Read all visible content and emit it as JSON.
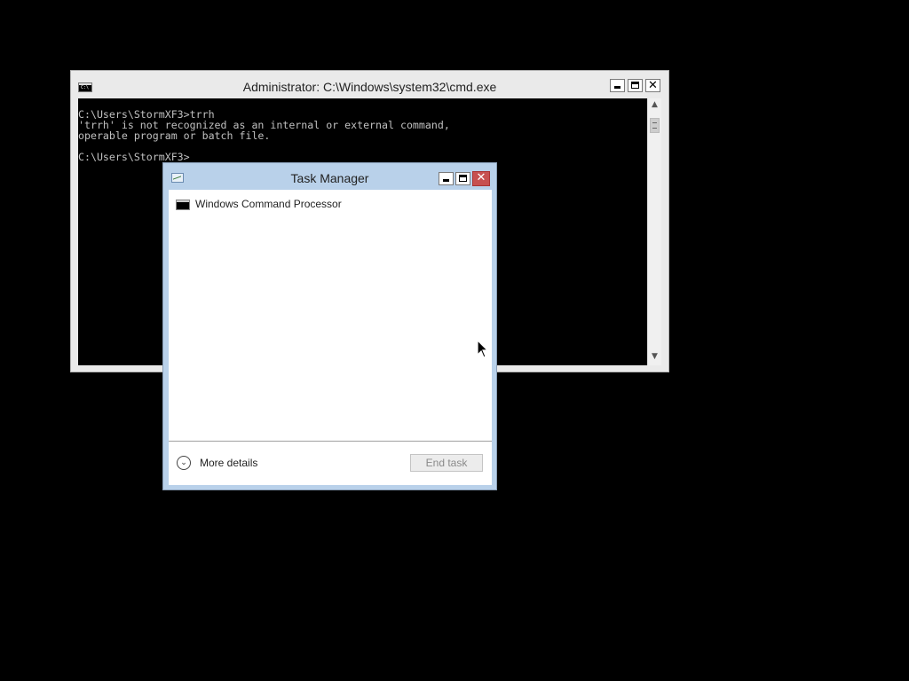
{
  "cmd": {
    "title": "Administrator: C:\\Windows\\system32\\cmd.exe",
    "icon_text": "C:\\",
    "console_text": "C:\\Users\\StormXF3>trrh\n'trrh' is not recognized as an internal or external command,\noperable program or batch file.\n\nC:\\Users\\StormXF3>",
    "minimize": "minimize-icon",
    "maximize": "maximize-icon",
    "close_glyph": "✕"
  },
  "task_manager": {
    "title": "Task Manager",
    "close_glyph": "✕",
    "processes": [
      {
        "label": "Windows Command Processor",
        "icon": "cmd-icon"
      }
    ],
    "more_details_label": "More details",
    "more_details_icon": "chevron-down-circle-icon",
    "end_task_label": "End task"
  },
  "colors": {
    "desktop": "#000000",
    "tm_frame": "#b9d1ea",
    "close_red": "#c75050"
  }
}
